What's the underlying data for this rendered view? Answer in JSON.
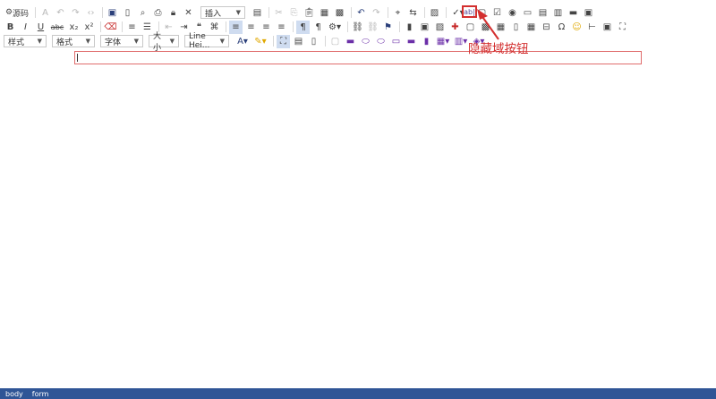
{
  "toolbar": {
    "row1": {
      "source_label": "源码",
      "insert_select_value": "插入"
    },
    "row2": {
      "bold": "B",
      "italic": "I",
      "underline": "U",
      "strike": "abc",
      "subscript": "x₂",
      "superscript": "x²",
      "quote": "❝"
    },
    "row3": {
      "style_select": "样式",
      "format_select": "格式",
      "font_select": "字体",
      "size_select": "大小",
      "lineheight_select": "Line Hei..."
    },
    "hidden_field_button_label": "ab|"
  },
  "annotation": {
    "text": "隐藏域按钮",
    "color": "#d32f2f"
  },
  "statusbar": {
    "path": [
      "body",
      "form"
    ],
    "color": "#2f5596"
  }
}
